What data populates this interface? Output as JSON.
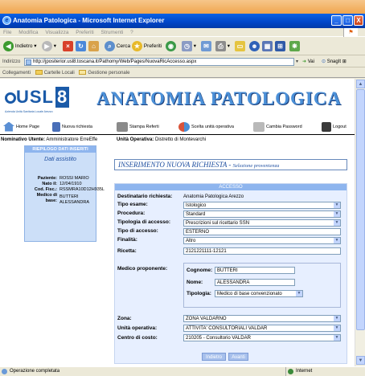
{
  "window": {
    "title": "Anatomia Patologica - Microsoft Internet Explorer",
    "controls": [
      "_",
      "□",
      "X"
    ]
  },
  "menubar": [
    "File",
    "Modifica",
    "Visualizza",
    "Preferiti",
    "Strumenti",
    "?"
  ],
  "toolbar": {
    "back": "Indietro",
    "search": "Cerca",
    "favorites": "Preferiti"
  },
  "address": {
    "label": "Indirizzo",
    "url": "http://jpositerior.usl8.toscana.it/Pathomy/Web/Pages/NuovaRicAccesso.aspx",
    "go": "Vai",
    "snagit": "SnagIt"
  },
  "links": {
    "label": "Collegamenti",
    "items": [
      "Cartelle Locali",
      "Gestione personale"
    ]
  },
  "app": {
    "logo": "USL",
    "logo_num": "8",
    "logo_sub": "Azienda Unità Sanitaria Locale Arezzo",
    "title": "ANATOMIA PATOLOGICA",
    "menu": [
      "Home Page",
      "Nuova richiesta",
      "Stampa Referti",
      "Scelta unità operativa",
      "Cambia Password",
      "Logout"
    ],
    "user_label": "Nominativo Utente:",
    "user_value": "Amministratore ErreEffe",
    "unit_label": "Unità Operativa:",
    "unit_value": "Distretto di Montevarchi"
  },
  "summary": {
    "header": "RIEPILOGO DATI INSERITI",
    "subtitle": "Dati assistito",
    "rows": [
      {
        "k": "Paziente:",
        "v": "ROSSI MARIO"
      },
      {
        "k": "Nato il:",
        "v": "12/04/1910"
      },
      {
        "k": "Cod. Fisc.:",
        "v": "RSSMRA10D12H935L"
      },
      {
        "k": "Medico di base:",
        "v": "BUTTERI ALESSANDRA"
      }
    ]
  },
  "form": {
    "title": "INSERIMENTO NUOVA RICHIESTA",
    "title_sep": "-",
    "title_sub": "Selezione provenienza",
    "section": "ACCESSO",
    "dest_label": "Destinatario richiesta:",
    "dest_value": "Anatomia Patologica Arezzo",
    "tipo_esame_label": "Tipo esame:",
    "tipo_esame": "Istologico",
    "procedura_label": "Procedura:",
    "procedura": "Standard",
    "tipologia_label": "Tipologia di accesso:",
    "tipologia": "Prescrizioni sul ricettario SSN",
    "tipo_accesso_label": "Tipo di accesso:",
    "tipo_accesso": "ESTERNO",
    "finalita_label": "Finalità:",
    "finalita": "Altro",
    "ricetta_label": "Ricetta:",
    "ricetta": "2121221111-12121",
    "medico_label": "Medico proponente:",
    "cognome_label": "Cognome:",
    "cognome": "BUTTERI",
    "nome_label": "Nome:",
    "nome": "ALESSANDRA",
    "tipologia_med_label": "Tipologia:",
    "tipologia_med": "Medico di base convenzionato",
    "zona_label": "Zona:",
    "zona": "ZONA VALDARNO",
    "unita_label": "Unità operativa:",
    "unita": "ATTIVITA' CONSULTORIALI VALDAR",
    "centro_label": "Centro di costo:",
    "centro": "210205 - Consultorio VALDAR",
    "back_button": "Indietro",
    "next_button": "Avanti"
  },
  "status": {
    "text": "Operazione completata",
    "zone": "Internet"
  },
  "colors": {
    "xp_title": "#0045c8",
    "panel_blue": "#ccdff8",
    "header_blue": "#8eb5ee",
    "title_blue": "#4b90d8"
  }
}
